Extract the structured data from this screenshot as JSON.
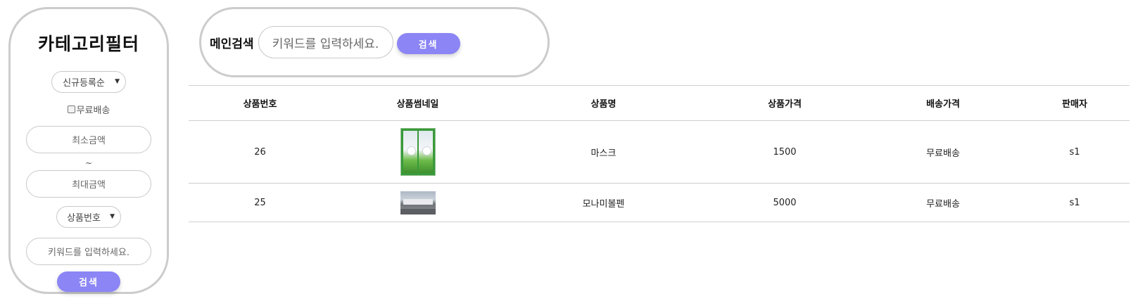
{
  "sidebar": {
    "title": "카테고리필터",
    "sort_select": {
      "value": "신규등록순"
    },
    "free_shipping": {
      "label": "무료배송",
      "checked": false
    },
    "min_price": {
      "placeholder": "최소금액"
    },
    "tilde": "~",
    "max_price": {
      "placeholder": "최대금액"
    },
    "field_select": {
      "value": "상품번호"
    },
    "keyword": {
      "placeholder": "키워드를 입력하세요."
    },
    "search_label": "검색"
  },
  "main_search": {
    "label": "메인검색",
    "placeholder": "키워드를 입력하세요.",
    "search_label": "검색"
  },
  "table": {
    "headers": [
      "상품번호",
      "상품썸네일",
      "상품명",
      "상품가격",
      "배송가격",
      "판매자"
    ],
    "rows": [
      {
        "id": "26",
        "thumbnail": "mask-product-thumbnail",
        "name": "마스크",
        "price": "1500",
        "shipping": "무료배송",
        "seller": "s1"
      },
      {
        "id": "25",
        "thumbnail": "building-photo-thumbnail",
        "name": "모나미볼펜",
        "price": "5000",
        "shipping": "무료배송",
        "seller": "s1"
      }
    ]
  },
  "colors": {
    "accent": "#8b85f5",
    "border": "#cccccc"
  }
}
